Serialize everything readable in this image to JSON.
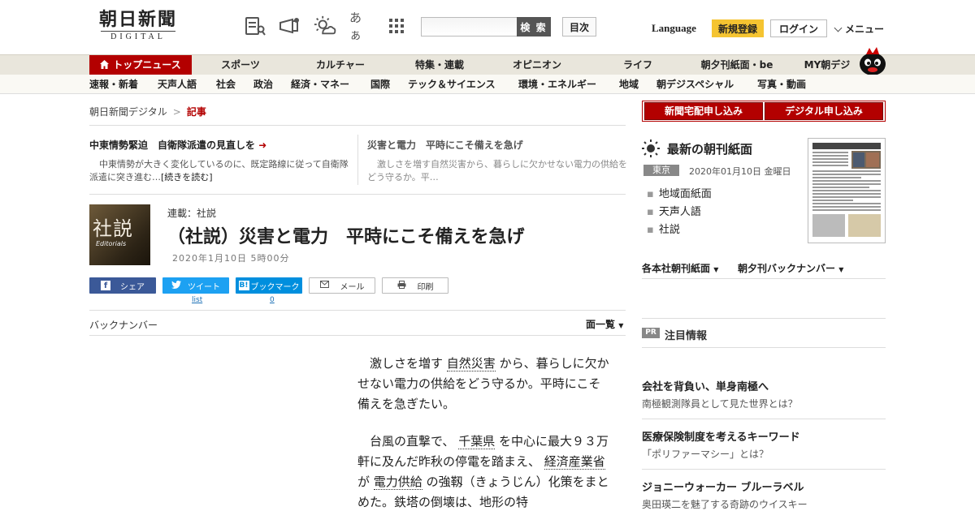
{
  "header": {
    "logo_main": "朝日新聞",
    "logo_sub": "DIGITAL",
    "search_button": "検 索",
    "index_button": "目次",
    "language": "Language",
    "signup": "新規登録",
    "login": "ログイン",
    "menu": "メニュー",
    "font_size_icon_label": "あぁ"
  },
  "nav_primary": [
    "トップニュース",
    "スポーツ",
    "カルチャー",
    "特集・連載",
    "オピニオン",
    "ライフ",
    "朝夕刊紙面・be",
    "MY朝デジ"
  ],
  "nav_secondary": [
    "速報・新着",
    "天声人語",
    "社会",
    "政治",
    "経済・マネー",
    "国際",
    "テック＆サイエンス",
    "環境・エネルギー",
    "地域",
    "朝デジスペシャル",
    "写真・動画"
  ],
  "breadcrumb": {
    "home": "朝日新聞デジタル",
    "sep": ">",
    "current": "記事"
  },
  "featured": [
    {
      "title": "中東情勢緊迫　自衛隊派遣の見直しを",
      "arrow": "➜",
      "body": "中東情勢が大きく変化しているのに、既定路線に従って自衛隊派遣に突き進む…",
      "more": "[続きを読む]"
    },
    {
      "title": "災害と電力　平時にこそ備えを急げ",
      "body": "激しさを増す自然災害から、暮らしに欠かせない電力の供給をどう守るか。平…"
    }
  ],
  "article": {
    "thumb_kanji": "社説",
    "thumb_en": "Editorials",
    "series": "連載：社説",
    "headline": "（社説）災害と電力　平時にこそ備えを急げ",
    "date": "2020年1月10日 5時00分",
    "back_number": "バックナンバー",
    "men_list": "面一覧"
  },
  "share": {
    "facebook": "シェア",
    "twitter": "ツイート",
    "twitter_sub": "list",
    "hatena": "ブックマーク",
    "hatena_sub": "0",
    "mail": "メール",
    "print": "印刷"
  },
  "body": {
    "p1_a": "激しさを増す",
    "p1_kw": "自然災害",
    "p1_b": "から、暮らしに欠かせない電力の供給をどう守るか。平時にこそ備えを急ぎたい。",
    "p2_a": "台風の直撃で、",
    "p2_kw1": "千葉県",
    "p2_b": "を中心に最大９３万軒に及んだ昨秋の停電を踏まえ、",
    "p2_kw2": "経済産業省",
    "p2_c": "が",
    "p2_kw3": "電力供給",
    "p2_d": "の強靱（きょうじん）化策をまとめた。鉄塔の倒壊は、地形の特"
  },
  "right": {
    "delivery_btn": "新聞宅配申し込み",
    "digital_btn": "デジタル申し込み",
    "paper_title": "最新の朝刊紙面",
    "region": "東京",
    "paper_date": "2020年01月10日 金曜日",
    "links": [
      "地域面紙面",
      "天声人語",
      "社説"
    ],
    "drop1": "各本社朝刊紙面",
    "drop2": "朝夕刊バックナンバー",
    "pr_badge": "PR",
    "pr_title": "注目情報",
    "ads": [
      {
        "title": "会社を背負い、単身南極へ",
        "sub": "南極観測隊員として見た世界とは？"
      },
      {
        "title": "医療保険制度を考えるキーワード",
        "sub": "「ポリファーマシー」とは？"
      },
      {
        "title": "ジョニーウォーカー ブルーラベル",
        "sub": "奥田瑛二を魅了する奇跡のウイスキー"
      }
    ]
  },
  "colors": {
    "brand_red": "#b30000",
    "signup_yellow": "#f5c431",
    "facebook": "#3b5998",
    "twitter": "#1da1f2",
    "hatena": "#008fde"
  }
}
